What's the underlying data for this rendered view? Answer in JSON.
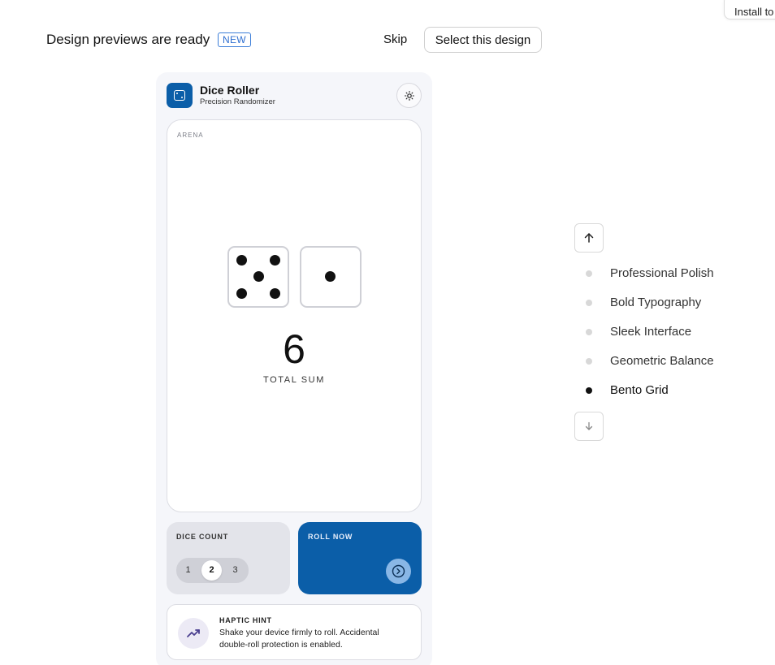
{
  "top_bar": {
    "install_label": "Install to",
    "title": "Design previews are ready",
    "badge": "NEW",
    "skip_label": "Skip",
    "select_label": "Select this design"
  },
  "app": {
    "title": "Dice Roller",
    "subtitle": "Precision Randomizer",
    "arena_label": "ARENA",
    "dice_values": [
      5,
      1
    ],
    "total_value": "6",
    "total_label": "TOTAL SUM",
    "dice_count": {
      "label": "DICE COUNT",
      "options": [
        "1",
        "2",
        "3"
      ],
      "selected": "2"
    },
    "roll": {
      "label": "ROLL NOW"
    },
    "hint": {
      "title": "HAPTIC HINT",
      "text": "Shake your device firmly to roll. Accidental double-roll protection is enabled."
    },
    "colors": {
      "primary": "#0b5ea8",
      "surface": "#f5f6fa"
    }
  },
  "design_picker": {
    "items": [
      {
        "label": "Professional Polish",
        "active": false
      },
      {
        "label": "Bold Typography",
        "active": false
      },
      {
        "label": "Sleek Interface",
        "active": false
      },
      {
        "label": "Geometric Balance",
        "active": false
      },
      {
        "label": "Bento Grid",
        "active": true
      }
    ],
    "icons": {
      "up": "arrow-up-icon",
      "down": "arrow-down-icon"
    }
  }
}
